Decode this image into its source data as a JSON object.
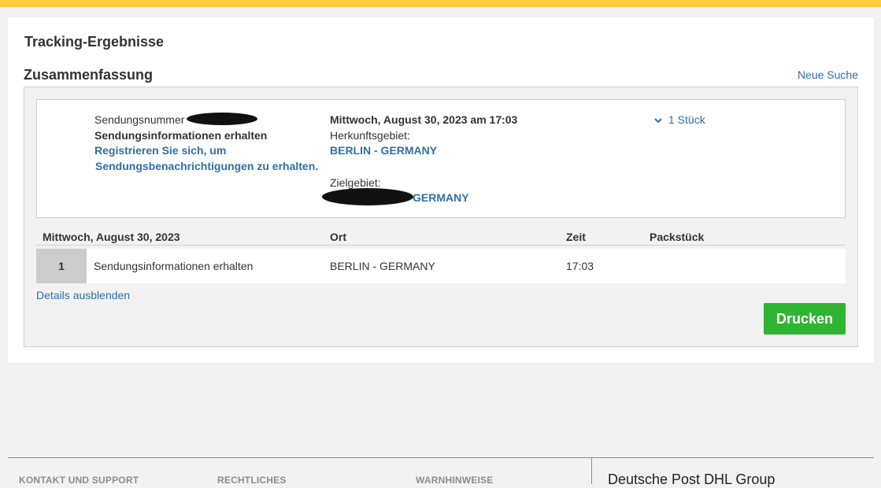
{
  "colors": {
    "brand_yellow": "#ffcc3d",
    "link_blue": "#2f6fa5",
    "print_green": "#2fb532"
  },
  "page": {
    "title": "Tracking-Ergebnisse"
  },
  "summary": {
    "title": "Zusammenfassung",
    "new_search": "Neue Suche",
    "shipment_number_label": "Sendungsnummer",
    "status": "Sendungsinformationen erhalten",
    "register_line1": "Registrieren Sie sich, um",
    "register_line2": "Sendungsbenachrichtigungen zu erhalten.",
    "datetime": "Mittwoch, August 30, 2023 am 17:03",
    "origin_label": "Herkunftsgebiet:",
    "origin_value": "BERLIN - GERMANY",
    "destination_label": "Zielgebiet:",
    "destination_value": "GERMANY",
    "pieces_toggle": "1 Stück",
    "pieces_icon": "chevron-down-icon"
  },
  "events": {
    "columns": {
      "date": "Mittwoch, August 30, 2023",
      "location": "Ort",
      "time": "Zeit",
      "piece": "Packstück"
    },
    "rows": [
      {
        "index": "1",
        "description": "Sendungsinformationen erhalten",
        "location": "BERLIN - GERMANY",
        "time": "17:03",
        "piece": ""
      }
    ]
  },
  "actions": {
    "hide_details": "Details ausblenden",
    "print": "Drucken"
  },
  "footer": {
    "links": [
      "KONTAKT UND SUPPORT",
      "RECHTLICHES",
      "WARNHINWEISE"
    ],
    "brand": "Deutsche Post DHL Group"
  }
}
